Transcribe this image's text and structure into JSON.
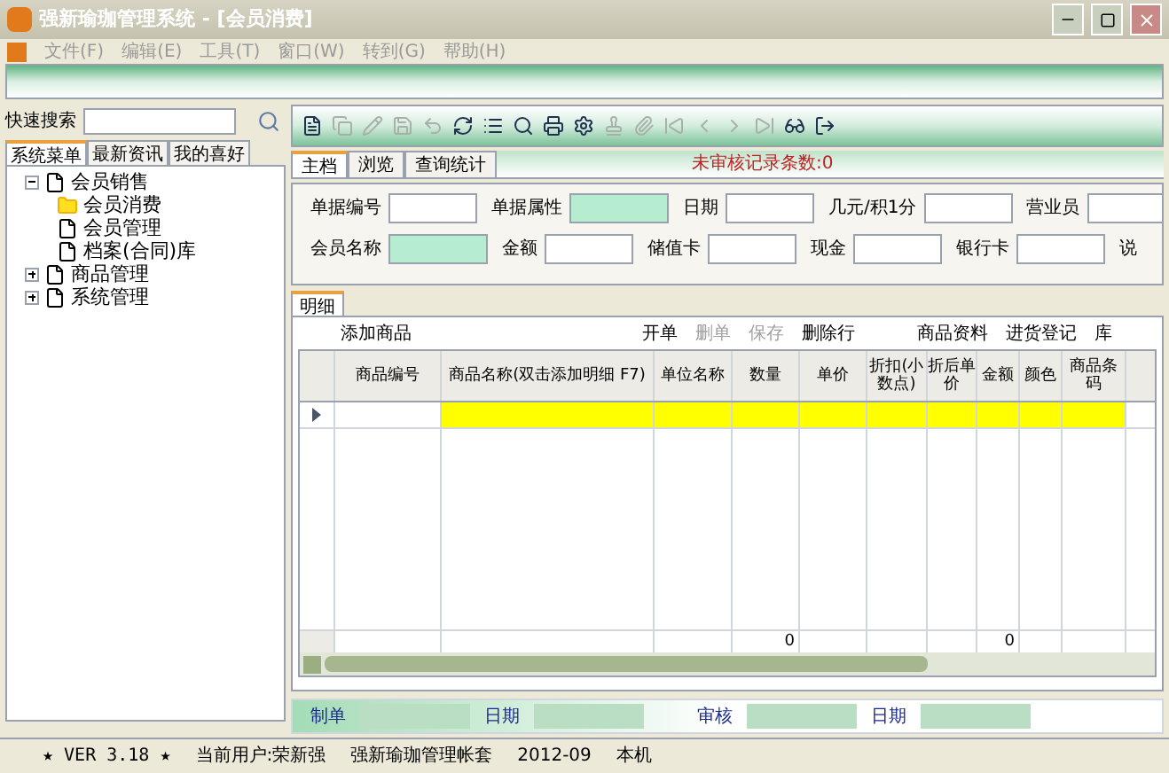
{
  "window": {
    "title": "强新瑜珈管理系统 - [会员消费]"
  },
  "menu": [
    "文件(F)",
    "编辑(E)",
    "工具(T)",
    "窗口(W)",
    "转到(G)",
    "帮助(H)"
  ],
  "quick_search": {
    "label": "快速搜索"
  },
  "sidebar_tabs": [
    {
      "label": "系统菜单",
      "selected": true
    },
    {
      "label": "最新资讯",
      "selected": false
    },
    {
      "label": "我的喜好",
      "selected": false
    }
  ],
  "tree": [
    {
      "label": "会员销售",
      "expanded": true,
      "children": [
        {
          "label": "会员消费",
          "selected": true
        },
        {
          "label": "会员管理",
          "selected": false
        },
        {
          "label": "档案(合同)库",
          "selected": false
        }
      ]
    },
    {
      "label": "商品管理",
      "expanded": false
    },
    {
      "label": "系统管理",
      "expanded": false
    }
  ],
  "toolbar": [
    {
      "kind": "new",
      "disabled": false
    },
    {
      "kind": "copy",
      "disabled": true
    },
    {
      "kind": "edit",
      "disabled": true
    },
    {
      "kind": "save",
      "disabled": true
    },
    {
      "kind": "undo",
      "disabled": true
    },
    {
      "kind": "refresh",
      "disabled": false
    },
    {
      "kind": "list",
      "disabled": false
    },
    {
      "kind": "preview",
      "disabled": false
    },
    {
      "kind": "print",
      "disabled": false
    },
    {
      "kind": "settings",
      "disabled": false
    },
    {
      "kind": "audit",
      "disabled": true
    },
    {
      "kind": "attach",
      "disabled": true
    },
    {
      "kind": "first",
      "disabled": true
    },
    {
      "kind": "prev",
      "disabled": true
    },
    {
      "kind": "next",
      "disabled": true
    },
    {
      "kind": "last",
      "disabled": true
    },
    {
      "kind": "glasses",
      "disabled": false
    },
    {
      "kind": "exit",
      "disabled": false
    }
  ],
  "main_tabs": [
    {
      "label": "主档",
      "selected": true
    },
    {
      "label": "浏览",
      "selected": false
    },
    {
      "label": "查询统计",
      "selected": false
    }
  ],
  "pending_notice": "未审核记录条数:0",
  "form_rows": [
    [
      {
        "label": "单据编号",
        "highlight": false
      },
      {
        "label": "单据属性",
        "highlight": true
      },
      {
        "label": "日期",
        "highlight": false
      },
      {
        "label": "几元/积1分",
        "highlight": false
      },
      {
        "label": "营业员",
        "highlight": false
      }
    ],
    [
      {
        "label": "会员名称",
        "highlight": true
      },
      {
        "label": "金额",
        "highlight": false
      },
      {
        "label": "储值卡",
        "highlight": false
      },
      {
        "label": "现金",
        "highlight": false
      },
      {
        "label": "银行卡",
        "highlight": false
      },
      {
        "label": "说"
      }
    ]
  ],
  "detail_tab": {
    "label": "明细"
  },
  "detail_actions": [
    {
      "label": "添加商品",
      "disabled": false
    },
    {
      "label": "开单",
      "disabled": false
    },
    {
      "label": "删单",
      "disabled": true
    },
    {
      "label": "保存",
      "disabled": true
    },
    {
      "label": "删除行",
      "disabled": false
    },
    {
      "label": "商品资料",
      "disabled": false
    },
    {
      "label": "进货登记",
      "disabled": false
    },
    {
      "label": "库",
      "disabled": false
    }
  ],
  "table": {
    "columns": [
      {
        "label": "商品编号"
      },
      {
        "label": "商品名称(双击添加明细 F7)"
      },
      {
        "label": "单位名称"
      },
      {
        "label": "数量",
        "total": "0"
      },
      {
        "label": "单价"
      },
      {
        "label": "折扣(小数点)"
      },
      {
        "label": "折后单价"
      },
      {
        "label": "金额",
        "total": "0"
      },
      {
        "label": "颜色"
      },
      {
        "label": "商品条码"
      }
    ]
  },
  "footer_fields": [
    {
      "label": "制单"
    },
    {
      "label": "日期"
    },
    {
      "label": "审核"
    },
    {
      "label": "日期"
    }
  ],
  "status_bar": [
    "★ VER 3.18 ★",
    "当前用户:荣新强",
    "强新瑜珈管理帐套",
    "2012-09",
    "本机"
  ]
}
